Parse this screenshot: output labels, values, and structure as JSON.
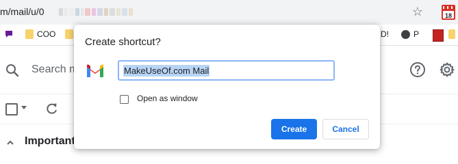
{
  "browser": {
    "url_prefix": "m/mail/u/0",
    "extension_badge": "18"
  },
  "bookmarks": [
    {
      "label": "COO",
      "icon": "folder-icon"
    },
    {
      "label": "D!",
      "icon": ""
    },
    {
      "label": "P",
      "icon": "globe-icon"
    }
  ],
  "gmail": {
    "search_placeholder": "Search m",
    "section_label": "Important"
  },
  "dialog": {
    "title": "Create shortcut?",
    "name_value": "MakeUseOf.com Mail",
    "open_as_window_label": "Open as window",
    "create_label": "Create",
    "cancel_label": "Cancel"
  },
  "colors": {
    "accent": "#1a73e8",
    "selection": "#b8d4f5",
    "input_focus_border": "#8ab4f8"
  }
}
